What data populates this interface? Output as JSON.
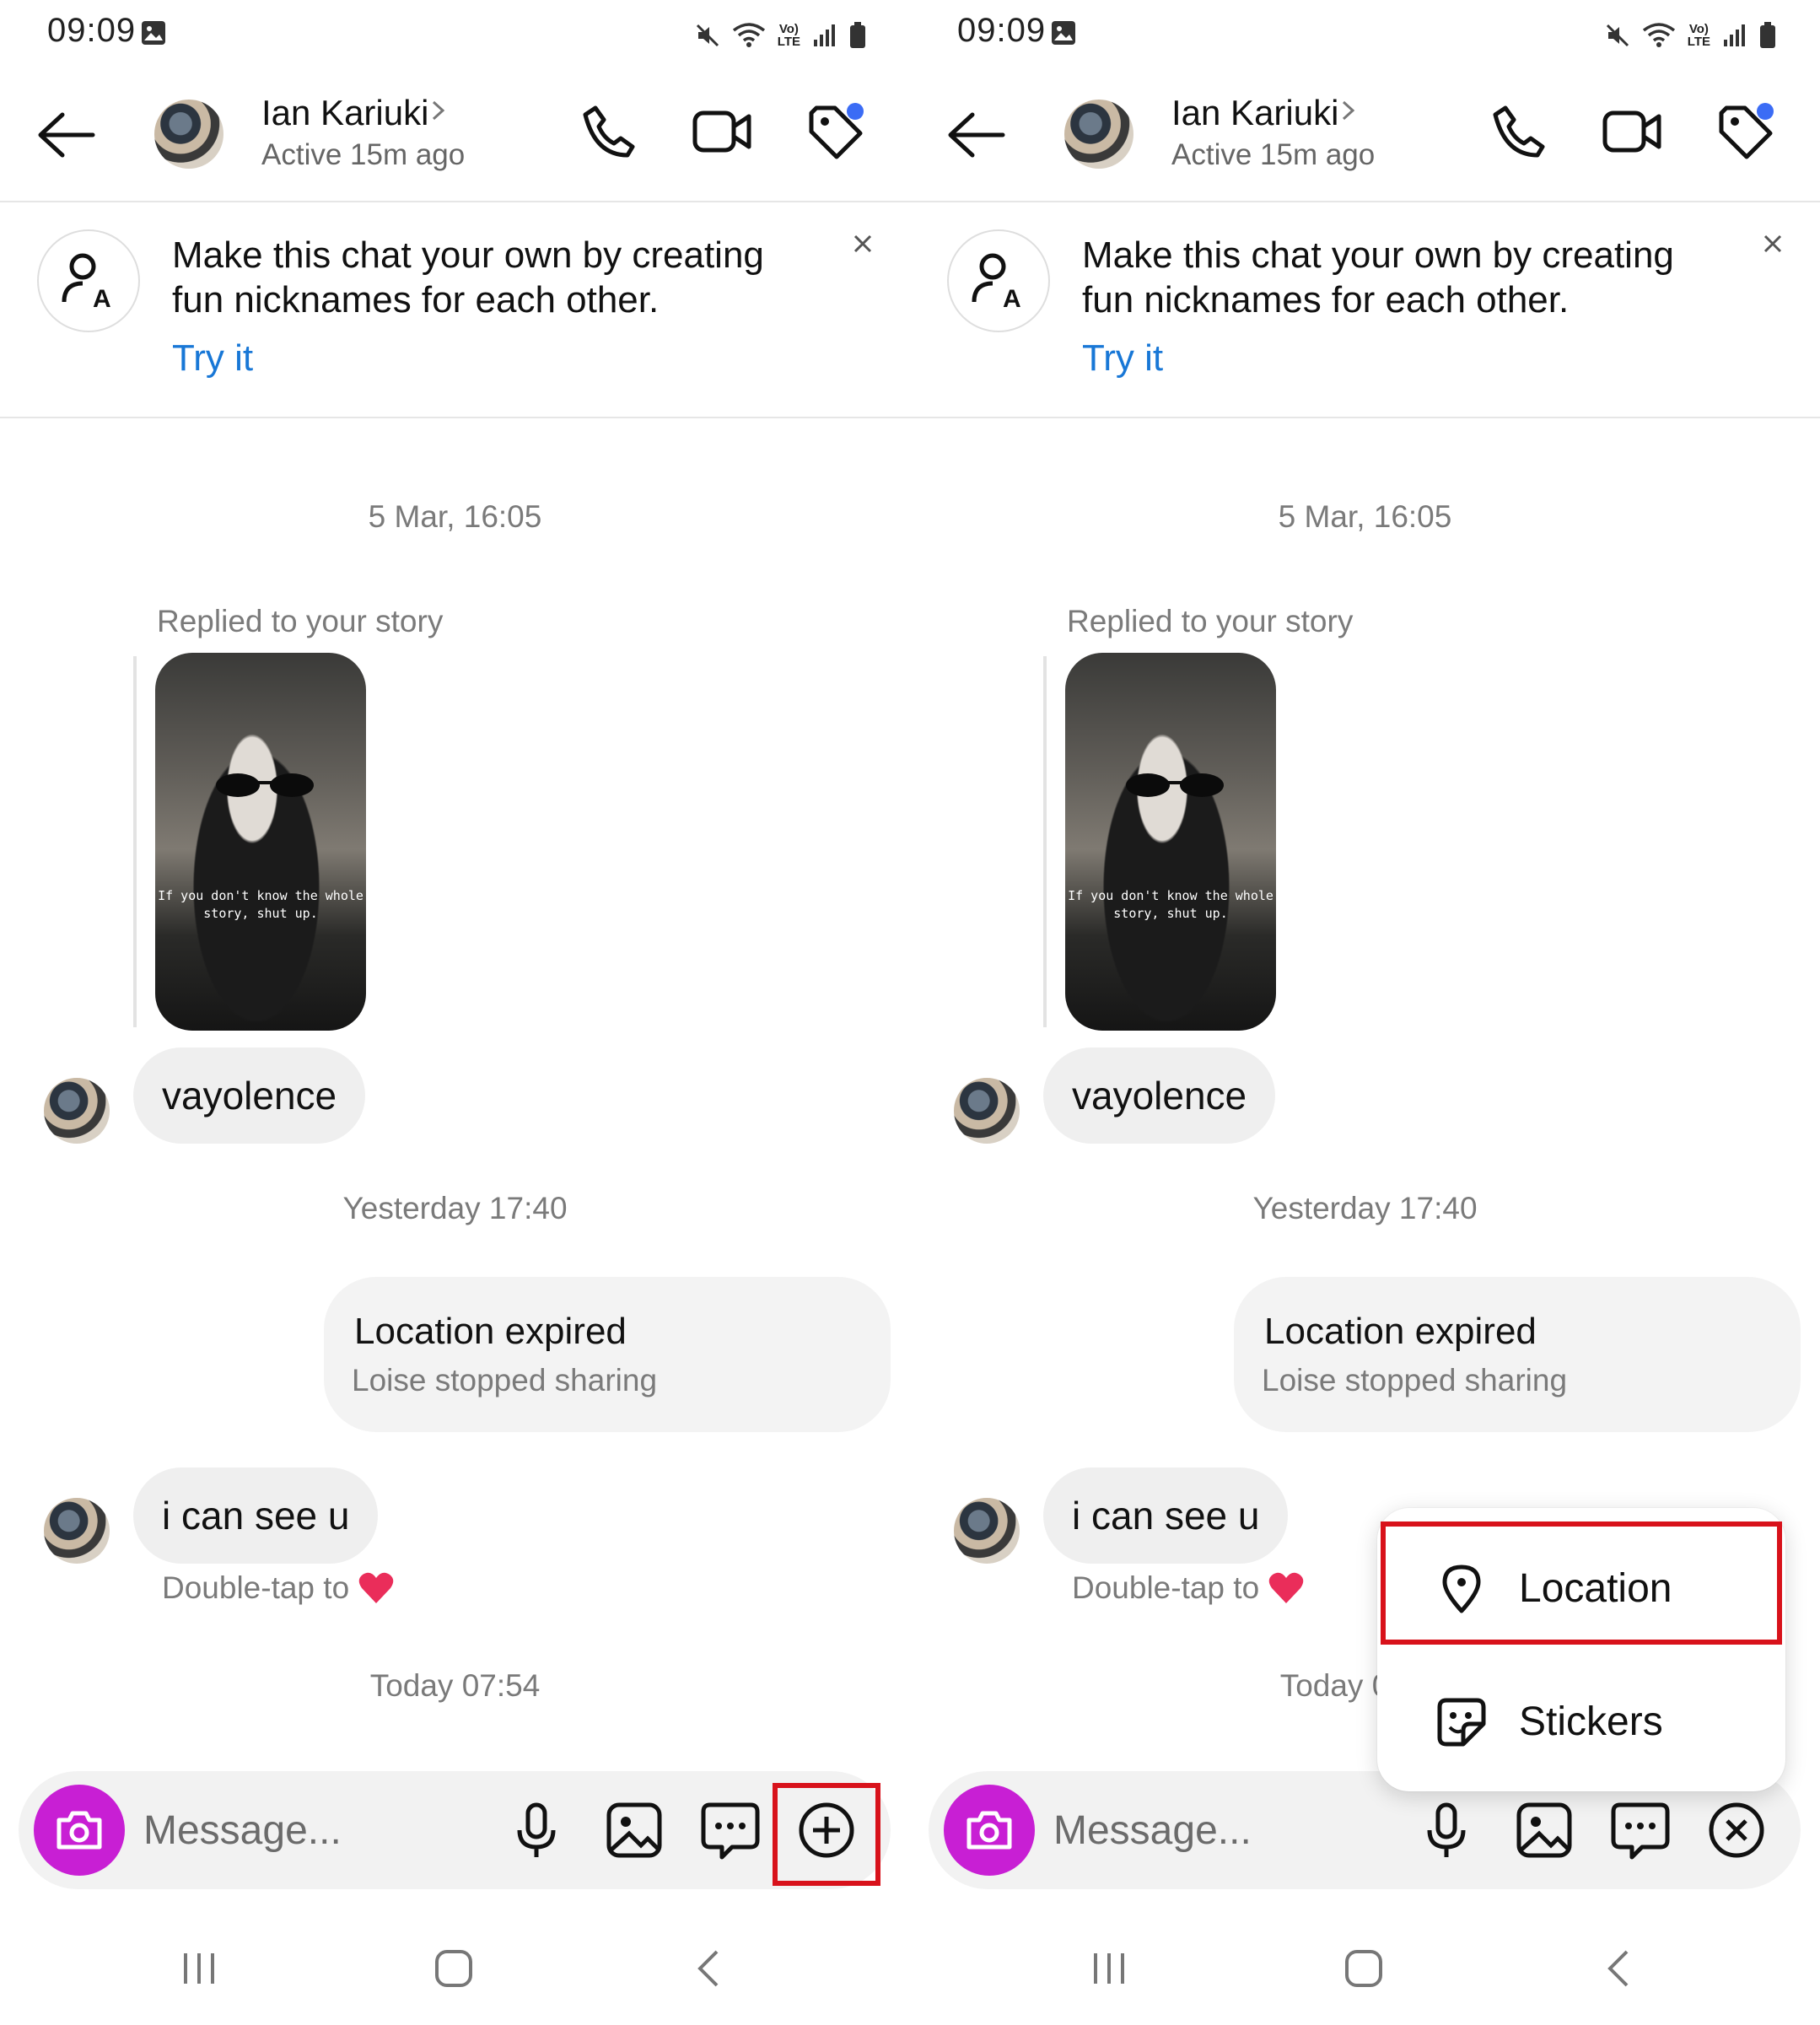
{
  "status_bar": {
    "time": "09:09",
    "volte_label": "VoLTE"
  },
  "header": {
    "name": "Ian Kariuki",
    "status": "Active 15m ago"
  },
  "banner": {
    "text": "Make this chat your own by creating fun nicknames for each other.",
    "action": "Try it"
  },
  "messages": {
    "date1": "5 Mar, 16:05",
    "replied_label": "Replied to your story",
    "story_caption": "If you don't know the whole story, shut up.",
    "msg1": "vayolence",
    "date2": "Yesterday 17:40",
    "location_title": "Location expired",
    "location_sub": "Loise stopped sharing",
    "msg2": "i can see u",
    "double_tap": "Double-tap to",
    "date3": "Today 07:54"
  },
  "composer": {
    "placeholder": "Message..."
  },
  "menu": {
    "items": [
      {
        "label": "Location",
        "icon": "location-pin-icon"
      },
      {
        "label": "Stickers",
        "icon": "sticker-icon"
      }
    ]
  },
  "colors": {
    "accent": "#1877d6",
    "camera": "#c81fd4",
    "highlight": "#d8121b",
    "badge": "#3b6cf5"
  }
}
